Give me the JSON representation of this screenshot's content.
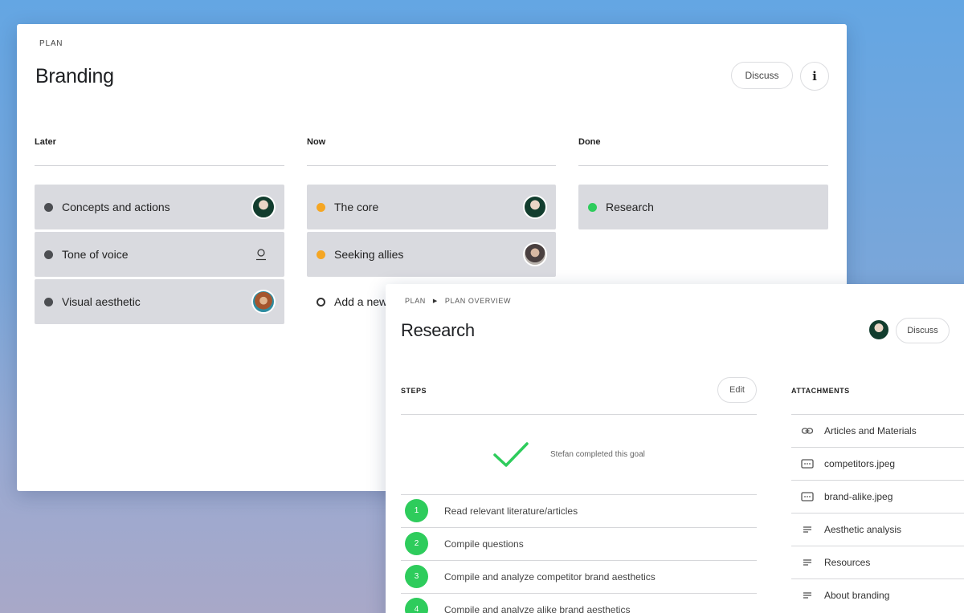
{
  "board": {
    "eyebrow": "PLAN",
    "title": "Branding",
    "discuss_label": "Discuss",
    "info_label": "i",
    "columns": [
      {
        "name": "Later",
        "tasks": [
          {
            "label": "Concepts and actions",
            "status": "grey",
            "assignee": "avatar-a"
          },
          {
            "label": "Tone of voice",
            "status": "grey",
            "assignee": "unassigned-user-icon"
          },
          {
            "label": "Visual aesthetic",
            "status": "grey",
            "assignee": "avatar-c"
          }
        ]
      },
      {
        "name": "Now",
        "tasks": [
          {
            "label": "The core",
            "status": "orange",
            "assignee": "avatar-a"
          },
          {
            "label": "Seeking allies",
            "status": "orange",
            "assignee": "avatar-b"
          }
        ],
        "add_label": "Add a new"
      },
      {
        "name": "Done",
        "tasks": [
          {
            "label": "Research",
            "status": "green",
            "assignee": ""
          }
        ]
      }
    ]
  },
  "detail": {
    "breadcrumb": [
      "PLAN",
      "PLAN OVERVIEW"
    ],
    "title": "Research",
    "discuss_label": "Discuss",
    "steps_heading": "STEPS",
    "edit_label": "Edit",
    "completed_text": "Stefan completed this goal",
    "steps": [
      {
        "num": "1",
        "label": "Read relevant literature/articles"
      },
      {
        "num": "2",
        "label": "Compile questions"
      },
      {
        "num": "3",
        "label": "Compile and analyze competitor brand aesthetics"
      },
      {
        "num": "4",
        "label": "Compile and analyze alike brand aesthetics"
      }
    ],
    "attachments_heading": "ATTACHMENTS",
    "attachments": [
      {
        "label": "Articles and Materials",
        "icon": "link-icon"
      },
      {
        "label": "competitors.jpeg",
        "icon": "image-file-icon"
      },
      {
        "label": "brand-alike.jpeg",
        "icon": "image-file-icon"
      },
      {
        "label": "Aesthetic analysis",
        "icon": "text-lines-icon"
      },
      {
        "label": "Resources",
        "icon": "text-lines-icon"
      },
      {
        "label": "About branding",
        "icon": "text-lines-icon"
      }
    ]
  },
  "colors": {
    "accent_green": "#2ecc5c",
    "status_orange": "#f5a623",
    "status_grey": "#4c4e52",
    "task_bg": "#d9dadf"
  }
}
